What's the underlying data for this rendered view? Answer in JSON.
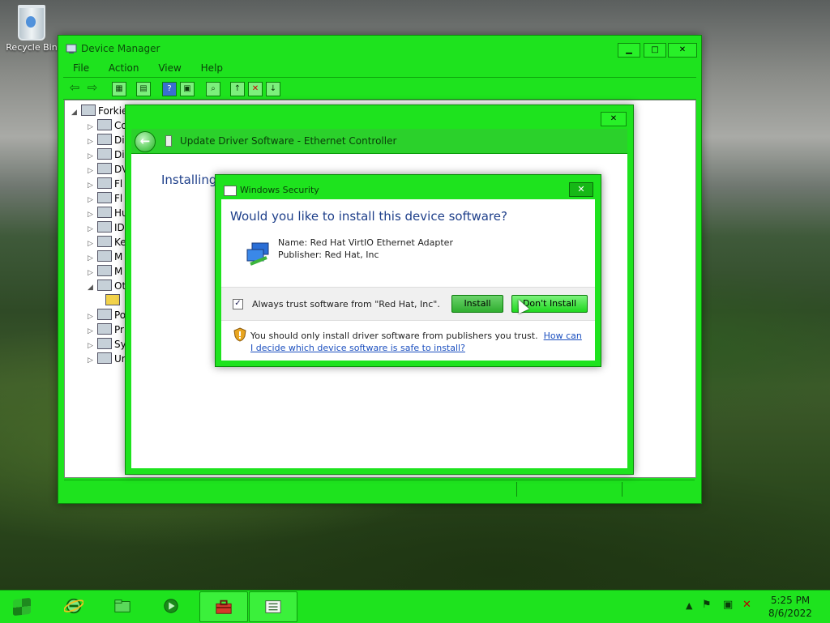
{
  "desktop": {
    "recycle_bin_label": "Recycle Bin"
  },
  "device_manager": {
    "title": "Device Manager",
    "menu": [
      "File",
      "Action",
      "View",
      "Help"
    ],
    "toolbar_icons": [
      "back-arrow-icon",
      "forward-arrow-icon",
      "show-hide-icon",
      "properties-icon",
      "help-icon",
      "view-icon",
      "scan-hardware-icon",
      "update-driver-icon",
      "uninstall-icon",
      "enable-device-icon"
    ],
    "tree": {
      "root": "Forkie",
      "items": [
        "Co",
        "Di",
        "Di",
        "DV",
        "Fl",
        "Fl",
        "Hu",
        "ID",
        "Ke",
        "M",
        "M",
        "Ot",
        "",
        "Po",
        "Pr",
        "Sy",
        "Ur"
      ]
    }
  },
  "update_driver": {
    "title": "Update Driver Software - Ethernet Controller",
    "status": "Installing driver software..."
  },
  "security": {
    "title": "Windows Security",
    "question": "Would you like to install this device software?",
    "name": "Name: Red Hat VirtIO Ethernet Adapter",
    "publisher": "Publisher: Red Hat, Inc",
    "always_trust": "Always trust software from \"Red Hat, Inc\".",
    "always_trust_checked": true,
    "install_label": "Install",
    "dont_install_label": "Don't Install",
    "warning_text": "You should only install driver software from publishers you trust.",
    "warning_link": "How can I decide which device software is safe to install?"
  },
  "taskbar": {
    "apps": [
      "internet-explorer-icon",
      "file-explorer-icon",
      "media-player-icon",
      "toolbox-icon",
      "device-manager-icon"
    ],
    "time": "5:25 PM",
    "date": "8/6/2022",
    "tray_icons": [
      "show-hidden-icons-arrow",
      "action-center-flag-icon",
      "network-icon",
      "volume-muted-icon"
    ]
  },
  "colors": {
    "window_frame": "#1ee31e",
    "heading_blue": "#1e3f8a",
    "link_blue": "#1b4fbf"
  }
}
